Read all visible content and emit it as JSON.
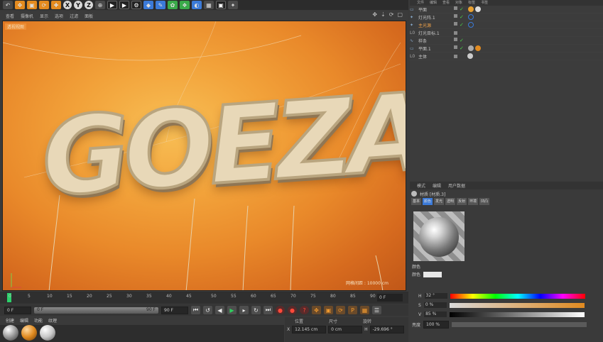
{
  "toolbar": {
    "axis_x": "X",
    "axis_y": "Y",
    "axis_z": "Z"
  },
  "viewport_menu": {
    "items": [
      "查看",
      "摄像机",
      "显示",
      "选项",
      "过滤",
      "面板"
    ]
  },
  "viewport": {
    "camera_label": "透视视图",
    "scene_text": "GOEZA",
    "grid_info": "网格间距 : 10000 cm"
  },
  "timeline": {
    "ticks": [
      "0",
      "5",
      "10",
      "15",
      "20",
      "25",
      "30",
      "35",
      "40",
      "45",
      "50",
      "55",
      "60",
      "65",
      "70",
      "75",
      "80",
      "85",
      "90"
    ],
    "current_frame": "0 F",
    "start_field": "0 F",
    "slider_start": "0 F",
    "slider_end": "90 F",
    "end_field": "90 F"
  },
  "materials": {
    "menu": [
      "创建",
      "编辑",
      "功能",
      "纹理"
    ]
  },
  "coordinates": {
    "headers": [
      "位置",
      "尺寸",
      "旋转"
    ],
    "row_x": {
      "axis": "X",
      "pos": "12.145 cm",
      "size": "0 cm",
      "rot": "H",
      "rot_val": "-29.696 °"
    }
  },
  "object_manager": {
    "menu": [
      "文件",
      "编辑",
      "查看",
      "对象",
      "标签",
      "书签"
    ],
    "objects": [
      {
        "name": "平面",
        "highlight": false
      },
      {
        "name": "灯光阵.1",
        "highlight": false
      },
      {
        "name": "主光源",
        "highlight": true
      },
      {
        "name": "灯光目标.1",
        "highlight": false
      },
      {
        "name": "样条",
        "highlight": false
      },
      {
        "name": "平面.1",
        "highlight": false
      },
      {
        "name": "主体",
        "highlight": false
      }
    ]
  },
  "attributes": {
    "menu": [
      "模式",
      "编辑",
      "用户数据"
    ],
    "material_name": "材质 [材质.3]",
    "tabs": [
      "基本",
      "颜色",
      "发光",
      "透明",
      "反射",
      "环境",
      "凹凸"
    ],
    "section": "颜色",
    "color_label": "颜色",
    "h_label": "H",
    "h_value": "32 °",
    "s_label": "S",
    "s_value": "0 %",
    "v_label": "V",
    "v_value": "85 %",
    "brightness_label": "亮度",
    "brightness_value": "100 %"
  }
}
